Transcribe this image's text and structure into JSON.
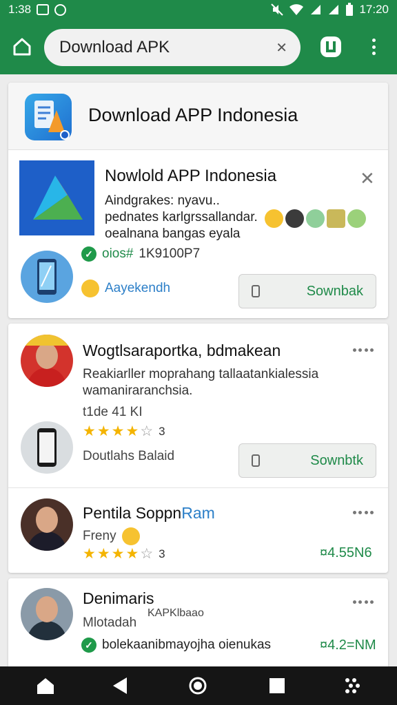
{
  "status_bar": {
    "time_left": "1:38",
    "time_right": "17:20"
  },
  "toolbar": {
    "search_text": "Download APK",
    "clear_label": "✕"
  },
  "card1": {
    "header_title": "Download APP Indonesia",
    "app_name": "Nowlold APP Indonesia",
    "description": "Aindgrakes: nyavu.. pednates karlgrssallandar. oealnana bangas eyala",
    "version": "oios#",
    "version_code": "1K9100P7",
    "developer": "Aayekendh",
    "button_label": "Sownbak"
  },
  "card2": {
    "title": "Wogtlsaraportka, bdmakean",
    "description": "Reakiarller moprahang tallaatankialessia wamaniraranchsia.",
    "meta": "t1de 41 KI",
    "rating": 3.5,
    "rating_count": "3",
    "developer": "Doutlahs Balaid",
    "button_label": "Sownbtk"
  },
  "card2b": {
    "title_black": "Pentila Soppn",
    "title_blue": "Ram",
    "subtitle": "Freny",
    "rating": 3.5,
    "rating_count": "3",
    "price": "¤4.55N6"
  },
  "card3": {
    "title": "Denimaris",
    "subtitle": "Mlotadah",
    "subtitle2": "KAPKlbaao",
    "bottom_text": "bolekaanibmayojha oienukas",
    "price": "¤4.2=NM"
  },
  "colors": {
    "accent": "#1f8a49",
    "link": "#2c7fc8",
    "star": "#f4b400"
  }
}
